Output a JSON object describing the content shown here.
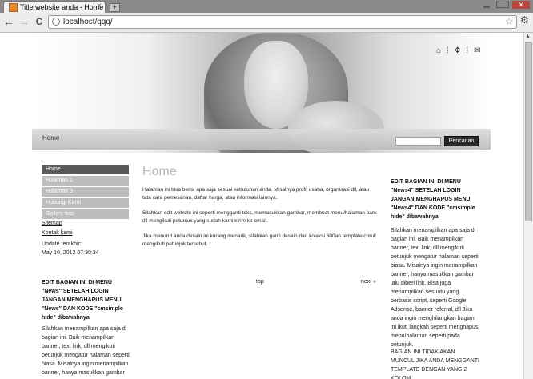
{
  "browser": {
    "tab_title": "Title website anda - Home",
    "new_tab": "+",
    "url": "localhost/qqq/",
    "close_icon": "×",
    "back_icon": "←",
    "forward_icon": "→",
    "reload_icon": "C",
    "star_icon": "☆",
    "wrench_icon": "🔧",
    "window_close": "✕"
  },
  "header": {
    "icons": "⌂ ⁞ ✥ ⁞ ✉"
  },
  "nav": {
    "home": "Home",
    "search_placeholder": "",
    "search_button": "Pencarian"
  },
  "sidebar": {
    "menu": [
      {
        "label": "Home"
      },
      {
        "label": "Halaman 2"
      },
      {
        "label": "Halaman 3"
      },
      {
        "label": "Hubungi Kami"
      },
      {
        "label": "Gallery foto"
      }
    ],
    "sitemap": "Sitemap",
    "contact": "Kontak kami",
    "updated_label": "Update terakhir:",
    "updated_value": "May 10, 2012 07:30:34",
    "block_title": "EDIT BAGIAN INI DI MENU \"News\" SETELAH LOGIN JANGAN MENGHAPUS MENU \"News\" DAN KODE \"cmsimple hide\" dibawahnya",
    "block_text": "Silahkan menampilkan apa saja di bagian ini. Baik menampilkan banner, text link, dll mengikuti petunjuk mengatur halaman seperti biasa. Misalnya ingin menampilkan banner, hanya masukkan gambar lalu diberi link. Bisa juga"
  },
  "main": {
    "title": "Home",
    "p1": "Halaman ini bisa berisi apa saja sesuai kebutuhan anda. Misalnya profil usaha, organisasi dll, atau tata cara pemesanan, daftar harga, atau informasi lainnya.",
    "p2": "Silahkan edit website ini seperti mengganti teks, memasukkan gambar, membuat menu/halaman baru dll mengikuti petunjuk yang sudah kami kirim ke email.",
    "p3": "Jika menurut anda desain ini kurang menarik, silahkan ganti desain dari koleksi 600an template coruk mengikuti petunjuk tersebut.",
    "top_link": "top",
    "next_link": "next »"
  },
  "right": {
    "block_title": "EDIT BAGIAN INI DI MENU \"News4\" SETELAH LOGIN JANGAN MENGHAPUS MENU \"News4\" DAN KODE \"cmsimple hide\" dibawahnya",
    "block_text": "Silahkan menampilkan apa saja di bagian ini. Baik menampilkan banner, text link, dll mengikuti petunjuk mengatur halaman seperti biasa. Misalnya ingin menampilkan banner, hanya masukkan gambar lalu diberi link. Bisa juga menampilkan sesuatu yang berbasis script, seperti Google Adsense, banner referral, dll Jika anda ingin menghilangkan bagian ini ikuti langkah seperti menghapus menu/halaman seperti pada petunjuk.",
    "note": "BAGIAN INI TIDAK AKAN MUNCUL JIKA ANDA MENGGANTI TEMPLATE DENGAN YANG 2 KOLOM"
  }
}
